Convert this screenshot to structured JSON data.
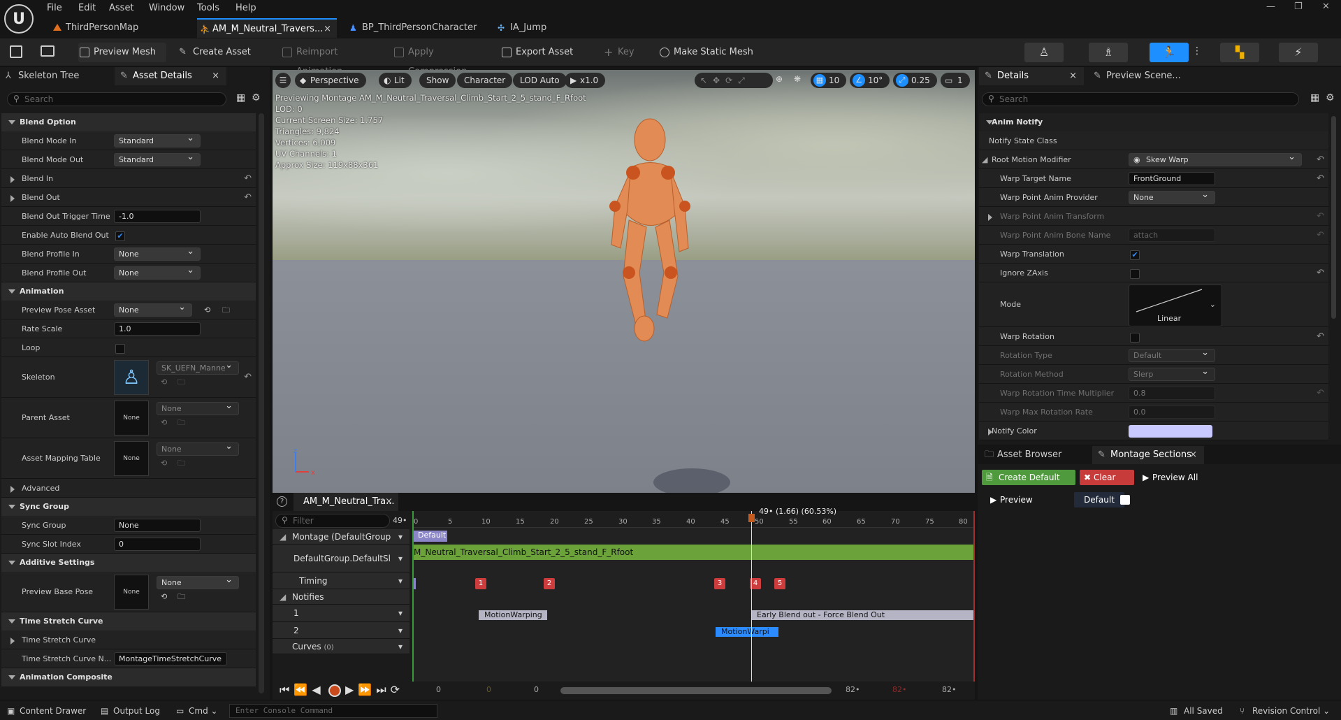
{
  "menu": {
    "file": "File",
    "edit": "Edit",
    "asset": "Asset",
    "window": "Window",
    "tools": "Tools",
    "help": "Help"
  },
  "tabs": [
    {
      "label": "ThirdPersonMap"
    },
    {
      "label": "AM_M_Neutral_Travers..."
    },
    {
      "label": "BP_ThirdPersonCharacter"
    },
    {
      "label": "IA_Jump"
    }
  ],
  "toolbar": {
    "preview_mesh": "Preview Mesh",
    "create_asset": "Create Asset",
    "reimport": "Reimport Animation",
    "apply_compression": "Apply Compression",
    "export_asset": "Export Asset",
    "key": "Key",
    "make_static_mesh": "Make Static Mesh"
  },
  "left_panel": {
    "tab_skeleton": "Skeleton Tree",
    "tab_details": "Asset Details",
    "search_placeholder": "Search",
    "blend_option": {
      "title": "Blend Option",
      "blend_mode_in": "Blend Mode In",
      "blend_mode_in_val": "Standard",
      "blend_mode_out": "Blend Mode Out",
      "blend_mode_out_val": "Standard",
      "blend_in": "Blend In",
      "blend_out": "Blend Out",
      "trigger_time": "Blend Out Trigger Time",
      "trigger_time_val": "-1.0",
      "auto_blend": "Enable Auto Blend Out",
      "profile_in": "Blend Profile In",
      "profile_in_val": "None",
      "profile_out": "Blend Profile Out",
      "profile_out_val": "None"
    },
    "animation": {
      "title": "Animation",
      "preview_pose": "Preview Pose Asset",
      "preview_pose_val": "None",
      "rate_scale": "Rate Scale",
      "rate_scale_val": "1.0",
      "loop": "Loop",
      "skeleton": "Skeleton",
      "skeleton_val": "SK_UEFN_Manne",
      "parent_asset": "Parent Asset",
      "parent_asset_val": "None",
      "thumb_none": "None",
      "mapping_table": "Asset Mapping Table",
      "mapping_table_val": "None",
      "advanced": "Advanced"
    },
    "sync_group": {
      "title": "Sync Group",
      "sync_group": "Sync Group",
      "sync_group_val": "None",
      "sync_slot": "Sync Slot Index",
      "sync_slot_val": "0"
    },
    "additive": {
      "title": "Additive Settings",
      "preview_base": "Preview Base Pose",
      "preview_base_val": "None"
    },
    "time_stretch": {
      "title": "Time Stretch Curve",
      "curve": "Time Stretch Curve",
      "curve_name": "Time Stretch Curve N...",
      "curve_name_val": "MontageTimeStretchCurve"
    },
    "composite": {
      "title": "Animation Composite"
    }
  },
  "viewport": {
    "perspective": "Perspective",
    "lit": "Lit",
    "show": "Show",
    "character": "Character",
    "lod": "LOD Auto",
    "speed": "x1.0",
    "grid": "10",
    "angle": "10°",
    "scale": "0.25",
    "cams": "1",
    "info": [
      "Previewing Montage AM_M_Neutral_Traversal_Climb_Start_2_5_stand_F_Rfoot",
      "LOD: 0",
      "Current Screen Size: 1.757",
      "Triangles: 9,824",
      "Vertices: 6,009",
      "UV Channels: 1",
      "Approx Size: 119x88x361"
    ]
  },
  "sequencer": {
    "tab": "AM_M_Neutral_Tra...",
    "filter_placeholder": "Filter",
    "frame_count": "49•",
    "playhead": "49• (1.66) (60.53%)",
    "ticks": [
      "0",
      "5",
      "10",
      "15",
      "20",
      "25",
      "30",
      "35",
      "40",
      "45",
      "50",
      "55",
      "60",
      "65",
      "70",
      "75",
      "80"
    ],
    "montage_label": "Montage (DefaultGroup",
    "section_default": "Default",
    "slot_label": "DefaultGroup.DefaultSl",
    "slot_anim": "M_Neutral_Traversal_Climb_Start_2_5_stand_F_Rfoot",
    "timing": "Timing",
    "markers": [
      "1",
      "2",
      "3",
      "4",
      "5"
    ],
    "notifies": "Notifies",
    "track1": "1",
    "track2": "2",
    "curves": "Curves",
    "curves_count": "(0)",
    "notify_motionwarp1": "MotionWarping",
    "notify_blendout": "Early Blend out - Force Blend Out",
    "notify_motionwarp2": "MotionWarpi",
    "transport": {
      "start": "0",
      "start2": "0",
      "start3": "0",
      "end1": "82•",
      "end2": "82•",
      "end3": "82•"
    }
  },
  "details": {
    "tab": "Details",
    "tab_preview": "Preview Scene...",
    "search_placeholder": "Search",
    "anim_notify": "Anim Notify",
    "notify_state_class": "Notify State Class",
    "root_motion_modifier": "Root Motion Modifier",
    "rmm_val": "Skew Warp",
    "warp_target_name": "Warp Target Name",
    "warp_target_val": "FrontGround",
    "warp_provider": "Warp Point Anim Provider",
    "warp_provider_val": "None",
    "warp_transform": "Warp Point Anim Transform",
    "warp_bone": "Warp Point Anim Bone Name",
    "warp_bone_val": "attach",
    "warp_translation": "Warp Translation",
    "ignore_z": "Ignore ZAxis",
    "mode": "Mode",
    "mode_val": "Linear",
    "warp_rotation": "Warp Rotation",
    "rotation_type": "Rotation Type",
    "rotation_type_val": "Default",
    "rotation_method": "Rotation Method",
    "rotation_method_val": "Slerp",
    "rot_time_mult": "Warp Rotation Time Multiplier",
    "rot_time_mult_val": "0.8",
    "max_rot_rate": "Warp Max Rotation Rate",
    "max_rot_rate_val": "0.0",
    "notify_color": "Notify Color",
    "notify_color_val": "#c9c8ff"
  },
  "montage_sections": {
    "tab_browser": "Asset Browser",
    "tab_sections": "Montage Sections",
    "create_default": "Create Default",
    "clear": "Clear",
    "preview_all": "Preview All",
    "preview": "Preview",
    "default": "Default"
  },
  "statusbar": {
    "content_drawer": "Content Drawer",
    "output_log": "Output Log",
    "cmd": "Cmd",
    "console_placeholder": "Enter Console Command",
    "all_saved": "All Saved",
    "revision_control": "Revision Control"
  },
  "colors": {
    "accent": "#1d8fff",
    "green": "#6ba33a",
    "red": "#cd3d3d",
    "notify": "#b4b4c4"
  }
}
